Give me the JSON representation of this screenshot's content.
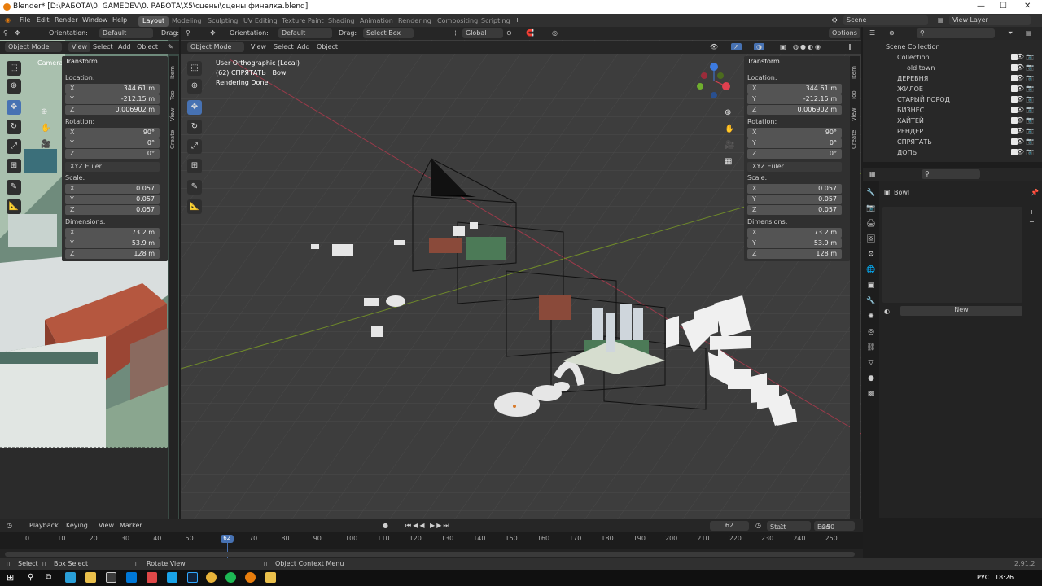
{
  "window": {
    "title": "Blender* [D:\\РАБОТА\\0. GAMEDEV\\0. РАБОТА\\X5\\сцены\\сцены финалка.blend]"
  },
  "menu": [
    "File",
    "Edit",
    "Render",
    "Window",
    "Help"
  ],
  "workspaces": [
    "Layout",
    "Modeling",
    "Sculpting",
    "UV Editing",
    "Texture Paint",
    "Shading",
    "Animation",
    "Rendering",
    "Compositing",
    "Scripting"
  ],
  "topright": {
    "scene": "Scene",
    "view_layer": "View Layer"
  },
  "left_view": {
    "orientation_label": "Orientation:",
    "orientation": "Default",
    "drag": "Drag:",
    "mode": "Object Mode",
    "view": "View",
    "select": "Select",
    "add": "Add",
    "object": "Object",
    "camera_label": "Camera"
  },
  "main_view": {
    "orientation_label": "Orientation:",
    "orientation": "Default",
    "drag": "Drag:",
    "drag_value": "Select Box",
    "transform": "Global",
    "options": "Options",
    "mode": "Object Mode",
    "view": "View",
    "select": "Select",
    "add": "Add",
    "object": "Object",
    "info1": "User Orthographic (Local)",
    "info2": "(62) СПРЯТАТЬ | Bowl",
    "info3": "Rendering Done"
  },
  "transform": {
    "title": "Transform",
    "location": "Location:",
    "rotation": "Rotation:",
    "scale": "Scale:",
    "dimensions": "Dimensions:",
    "euler": "XYZ Euler",
    "loc": [
      "344.61 m",
      "-212.15 m",
      "0.006902 m"
    ],
    "rot": [
      "90°",
      "0°",
      "0°"
    ],
    "scl": [
      "0.057",
      "0.057",
      "0.057"
    ],
    "dim": [
      "73.2 m",
      "53.9 m",
      "128 m"
    ]
  },
  "side_tabs": [
    "Item",
    "Tool",
    "View",
    "Create"
  ],
  "outliner": {
    "root": "Scene Collection",
    "rows": [
      {
        "name": "Collection"
      },
      {
        "name": "old town"
      },
      {
        "name": "ДЕРЕВНЯ"
      },
      {
        "name": "ЖИЛОЕ"
      },
      {
        "name": "СТАРЫЙ ГОРОД"
      },
      {
        "name": "БИЗНЕС"
      },
      {
        "name": "ХАЙТЕЙ"
      },
      {
        "name": "РЕНДЕР"
      },
      {
        "name": "СПРЯТАТЬ"
      },
      {
        "name": "ДОПЫ"
      }
    ]
  },
  "props": {
    "material": "Bowl",
    "new": "New"
  },
  "timeline": {
    "playback": "Playback",
    "keying": "Keying",
    "view": "View",
    "marker": "Marker",
    "frame": "62",
    "start_label": "Start",
    "start": "1",
    "end_label": "End",
    "end": "250",
    "ticks": [
      "0",
      "10",
      "20",
      "30",
      "40",
      "50",
      "62",
      "70",
      "80",
      "90",
      "100",
      "110",
      "120",
      "130",
      "140",
      "150",
      "160",
      "170",
      "180",
      "190",
      "200",
      "210",
      "220",
      "230",
      "240",
      "250"
    ]
  },
  "status": {
    "select": "Select",
    "box_select": "Box Select",
    "rotate": "Rotate View",
    "context": "Object Context Menu",
    "version": "2.91.2"
  },
  "taskbar": {
    "lang": "РУС",
    "time": "18:26"
  },
  "colors": {
    "accent": "#4772b3",
    "orange": "#e87d0d"
  }
}
